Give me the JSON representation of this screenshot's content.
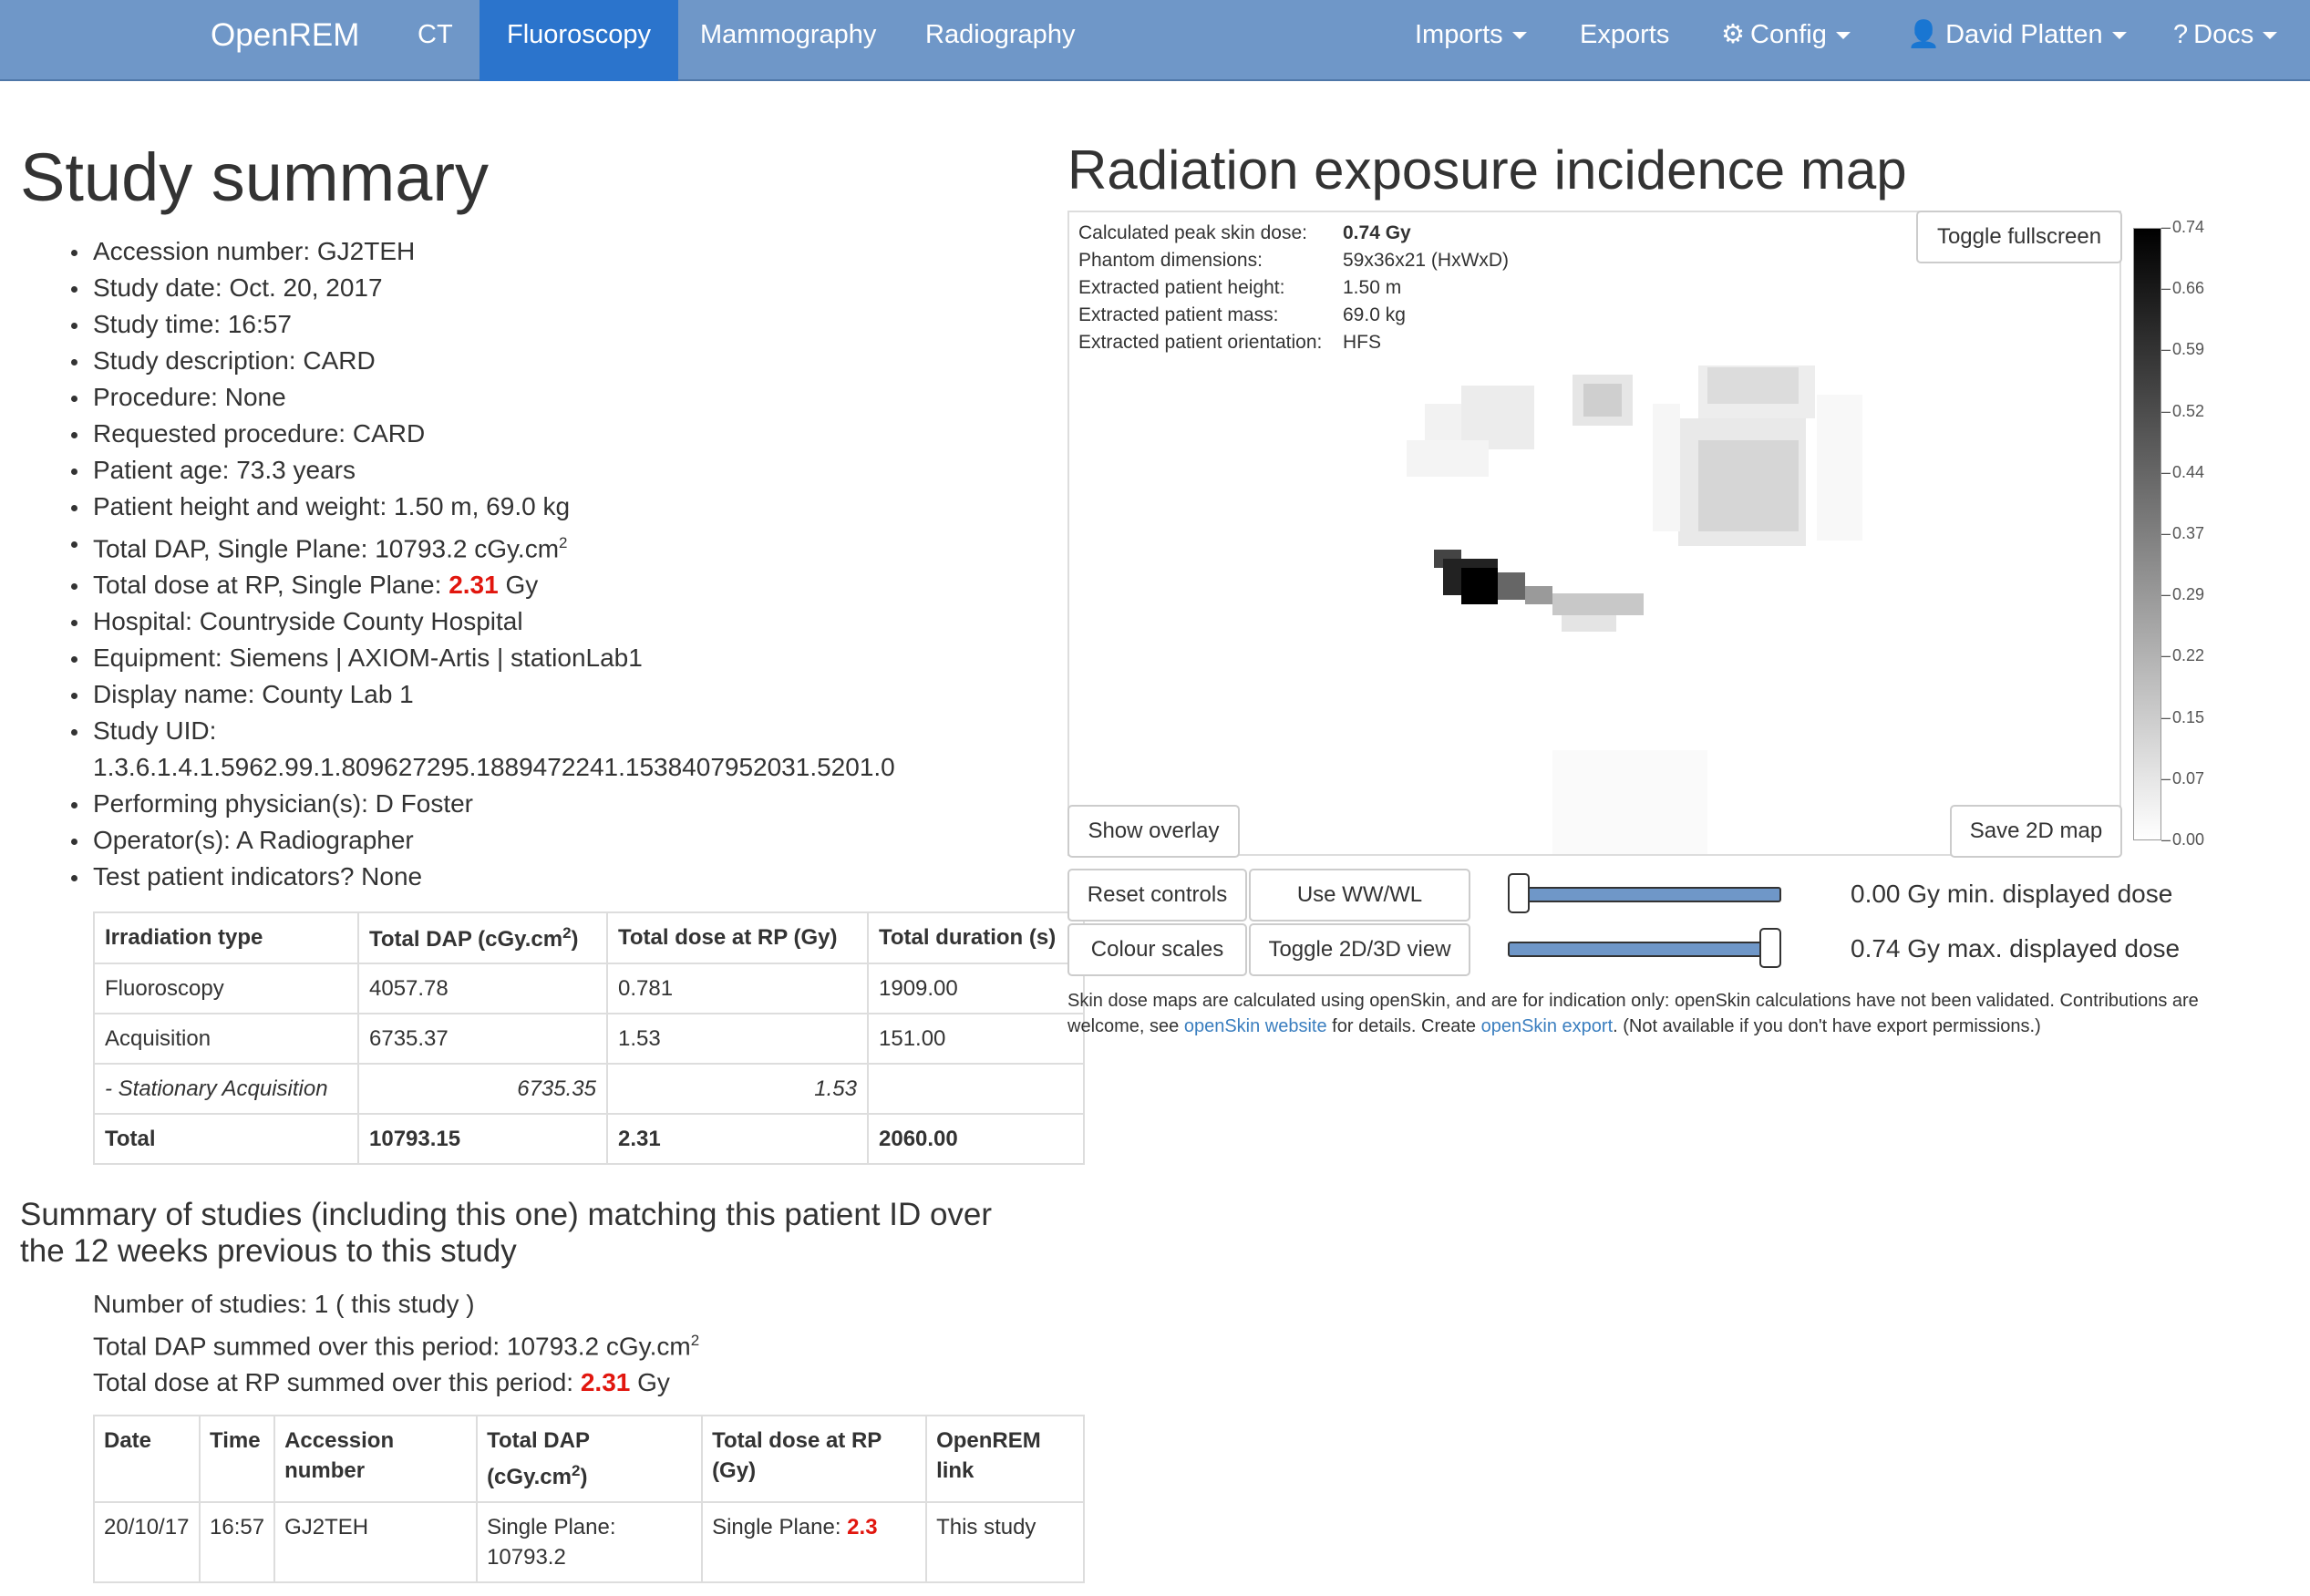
{
  "nav": {
    "brand": "OpenREM",
    "items": [
      "CT",
      "Fluoroscopy",
      "Mammography",
      "Radiography"
    ],
    "active": "Fluoroscopy",
    "right": {
      "imports": "Imports",
      "exports": "Exports",
      "config": "Config",
      "user": "David Platten",
      "docs": "Docs"
    }
  },
  "summary": {
    "title": "Study summary",
    "details": [
      {
        "label": "Accession number: ",
        "value": "GJ2TEH"
      },
      {
        "label": "Study date: ",
        "value": "Oct. 20, 2017"
      },
      {
        "label": "Study time: ",
        "value": "16:57"
      },
      {
        "label": "Study description: ",
        "value": "CARD"
      },
      {
        "label": "Procedure: ",
        "value": "None"
      },
      {
        "label": "Requested procedure: ",
        "value": "CARD"
      },
      {
        "label": "Patient age: ",
        "value": "73.3 years"
      },
      {
        "label": "Patient height and weight: ",
        "value": "1.50 m, 69.0 kg"
      },
      {
        "label": "Total DAP, Single Plane: ",
        "value": "10793.2 cGy.cm",
        "sup": "2"
      },
      {
        "label": "Total dose at RP, Single Plane: ",
        "value_red": "2.31",
        "suffix": " Gy"
      },
      {
        "label": "Hospital: ",
        "value": "Countryside County Hospital"
      },
      {
        "label": "Equipment: ",
        "value": "Siemens | AXIOM-Artis | stationLab1"
      },
      {
        "label": "Display name: ",
        "value": "County Lab 1"
      },
      {
        "label": "Study UID:",
        "value": ""
      },
      {
        "label": "",
        "value": "1.3.6.1.4.1.5962.99.1.809627295.1889472241.1538407952031.5201.0",
        "continuation": true
      },
      {
        "label": "Performing physician(s): ",
        "value": "D Foster"
      },
      {
        "label": "Operator(s): ",
        "value": "A Radiographer"
      },
      {
        "label": "Test patient indicators? ",
        "value": "None"
      }
    ]
  },
  "irradiation_table": {
    "headers": {
      "type": "Irradiation type",
      "dap": "Total DAP (cGy.cm",
      "dap_sup": "2",
      "dap_close": ")",
      "rp": "Total dose at RP (Gy)",
      "duration": "Total duration (s)"
    },
    "rows": [
      {
        "type": "Fluoroscopy",
        "dap": "4057.78",
        "rp": "0.781",
        "duration": "1909.00"
      },
      {
        "type": "Acquisition",
        "dap": "6735.37",
        "rp": "1.53",
        "duration": "151.00"
      },
      {
        "type": "- Stationary Acquisition",
        "dap": "6735.35",
        "rp": "1.53",
        "duration": ""
      },
      {
        "type": "Total",
        "dap": "10793.15",
        "rp": "2.31",
        "duration": "2060.00"
      }
    ]
  },
  "matching": {
    "heading": "Summary of studies (including this one) matching this patient ID over the 12 weeks previous to this study",
    "num_studies": "Number of studies: 1 ( this study )",
    "dap_line": "Total DAP summed over this period: 10793.2 cGy.cm",
    "dap_sup": "2",
    "rp_line": "Total dose at RP summed over this period: ",
    "rp_value": "2.31",
    "rp_suffix": " Gy"
  },
  "study_table": {
    "headers": {
      "date": "Date",
      "time": "Time",
      "accession": "Accession number",
      "dap": "Total DAP (cGy.cm",
      "dap_sup": "2",
      "dap_close": ")",
      "rp": "Total dose at RP (Gy)",
      "link": "OpenREM link"
    },
    "row": {
      "date": "20/10/17",
      "time": "16:57",
      "accession": "GJ2TEH",
      "dap": "Single Plane: 10793.2",
      "rp_label": "Single Plane: ",
      "rp_value": "2.3",
      "link": "This study"
    }
  },
  "map": {
    "title": "Radiation exposure incidence map",
    "info": [
      {
        "k": "Calculated peak skin dose:",
        "v": "0.74 Gy"
      },
      {
        "k": "Phantom dimensions:",
        "v": "59x36x21 (HxWxD)"
      },
      {
        "k": "Extracted patient height:",
        "v": "1.50 m"
      },
      {
        "k": "Extracted patient mass:",
        "v": "69.0 kg"
      },
      {
        "k": "Extracted patient orientation:",
        "v": "HFS"
      }
    ],
    "buttons": {
      "fullscreen": "Toggle fullscreen",
      "overlay": "Show overlay",
      "save": "Save 2D map",
      "reset": "Reset controls",
      "wwwl": "Use WW/WL",
      "colour": "Colour scales",
      "toggle3d": "Toggle 2D/3D view"
    },
    "colorbar_ticks": [
      "0.74",
      "0.66",
      "0.59",
      "0.52",
      "0.44",
      "0.37",
      "0.29",
      "0.22",
      "0.15",
      "0.07",
      "0.00"
    ],
    "min_label": "0.00 Gy min. displayed dose",
    "max_label": "0.74 Gy max. displayed dose",
    "min_fraction": 0.0,
    "max_fraction": 1.0,
    "note": {
      "part1": "Skin dose maps are calculated using openSkin, and are for indication only: openSkin calculations have not been validated. Contributions are welcome, see ",
      "link1": "openSkin website",
      "part2": " for details. Create ",
      "link2": "openSkin export",
      "part3": ". (Not available if you don't have export permissions.)"
    }
  }
}
